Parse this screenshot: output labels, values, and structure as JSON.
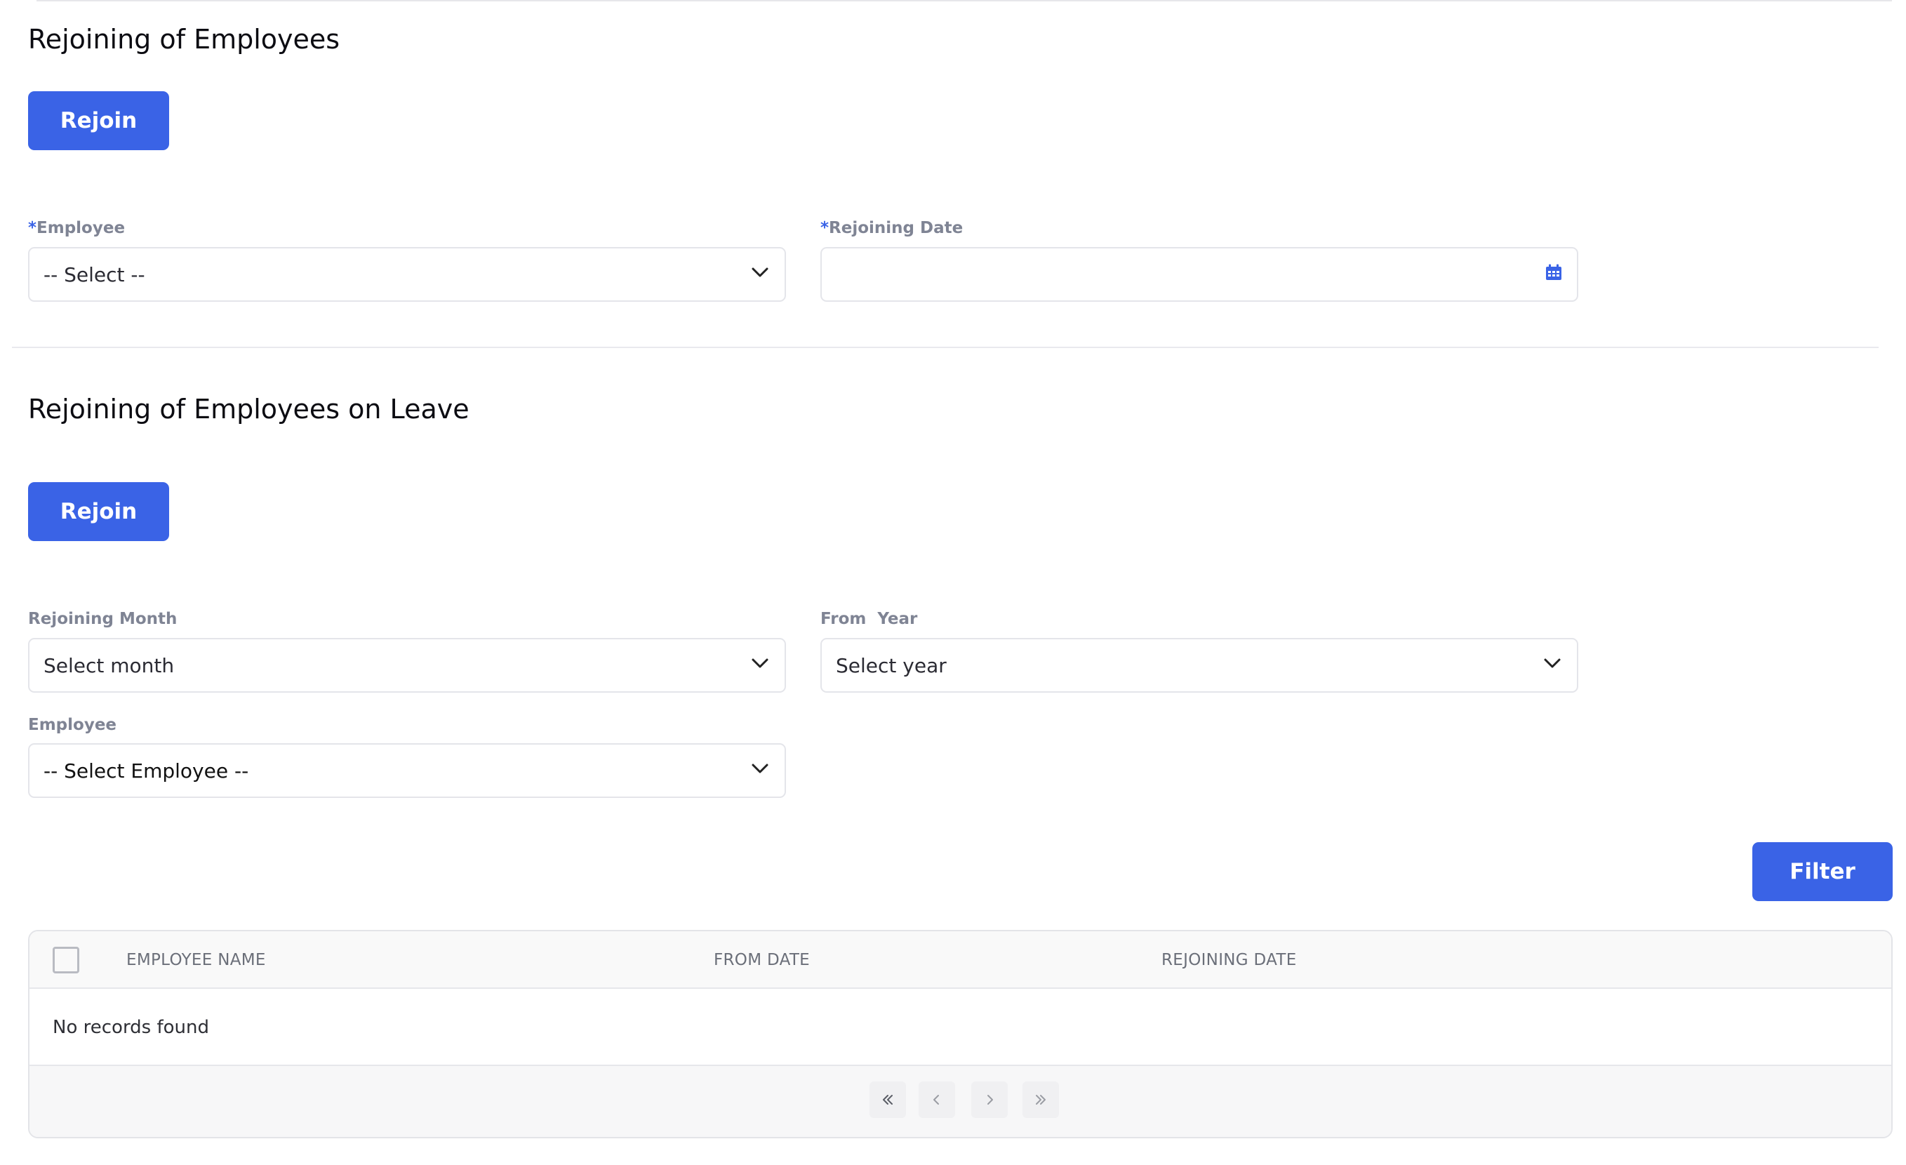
{
  "section1": {
    "title": "Rejoining of Employees",
    "rejoin_label": "Rejoin",
    "employee_field": {
      "required_mark": "*",
      "label": "Employee",
      "value": "-- Select --"
    },
    "rejoining_date_field": {
      "required_mark": "*",
      "label": "Rejoining Date",
      "value": ""
    }
  },
  "section2": {
    "title": "Rejoining of Employees on Leave",
    "rejoin_label": "Rejoin",
    "month_field": {
      "label": "Rejoining Month",
      "value": "Select month"
    },
    "year_field": {
      "label": "From  Year",
      "value": "Select year"
    },
    "employee_field": {
      "label": "Employee",
      "value": "-- Select Employee --"
    },
    "filter_label": "Filter"
  },
  "table": {
    "columns": [
      "EMPLOYEE NAME",
      "FROM DATE",
      "REJOINING DATE"
    ],
    "empty_message": "No records found"
  },
  "icons": {
    "dropdown": "chevron-down-icon",
    "calendar": "calendar-icon",
    "pagination": [
      "first-page-icon",
      "prev-page-icon",
      "next-page-icon",
      "last-page-icon"
    ]
  },
  "colors": {
    "primary": "#3a63e6",
    "label": "#7f8494",
    "border": "#e4e5ea"
  }
}
